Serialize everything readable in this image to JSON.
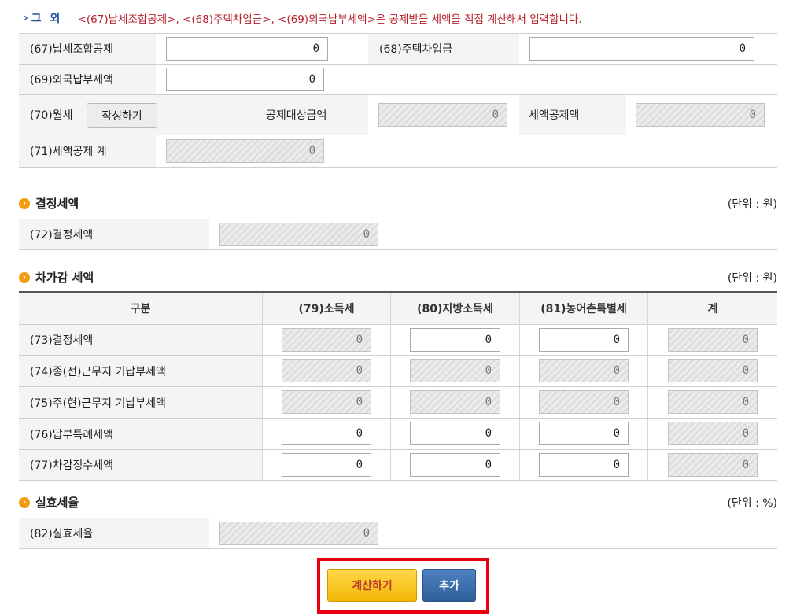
{
  "notice": {
    "prefix": "그 외",
    "text": "- <(67)납세조합공제>, <(68)주택차입금>, <(69)외국납부세액>은 공제받을 세액을 직접 계산해서 입력합니다."
  },
  "deduction": {
    "r67_label": "(67)납세조합공제",
    "r67_value": "0",
    "r68_label": "(68)주택차입금",
    "r68_value": "0",
    "r69_label": "(69)외국납부세액",
    "r69_value": "0",
    "r70_label": "(70)월세",
    "r70_button": "작성하기",
    "r70_base_label": "공제대상금액",
    "r70_base_value": "0",
    "r70_tax_label": "세액공제액",
    "r70_tax_value": "0",
    "r71_label": "(71)세액공제 계",
    "r71_value": "0"
  },
  "determined": {
    "title": "결정세액",
    "unit": "(단위 : 원)",
    "r72_label": "(72)결정세액",
    "r72_value": "0"
  },
  "diff": {
    "title": "차가감 세액",
    "unit": "(단위 : 원)",
    "headers": [
      "구분",
      "(79)소득세",
      "(80)지방소득세",
      "(81)농어촌특별세",
      "계"
    ],
    "rows": [
      {
        "label": "(73)결정세액",
        "v": [
          "0",
          "0",
          "0",
          "0"
        ]
      },
      {
        "label": "(74)종(전)근무지 기납부세액",
        "v": [
          "0",
          "0",
          "0",
          "0"
        ]
      },
      {
        "label": "(75)주(현)근무지 기납부세액",
        "v": [
          "0",
          "0",
          "0",
          "0"
        ]
      },
      {
        "label": "(76)납부특례세액",
        "v": [
          "0",
          "0",
          "0",
          "0"
        ]
      },
      {
        "label": "(77)차감징수세액",
        "v": [
          "0",
          "0",
          "0",
          "0"
        ]
      }
    ]
  },
  "effective": {
    "title": "실효세율",
    "unit": "(단위 : %)",
    "r82_label": "(82)실효세율",
    "r82_value": "0"
  },
  "actions": {
    "calc_label": "계산하기",
    "add_label": "추가",
    "calc_color": "#f5c518",
    "add_color": "#3f6ea8",
    "highlight_color": "#e60012"
  }
}
